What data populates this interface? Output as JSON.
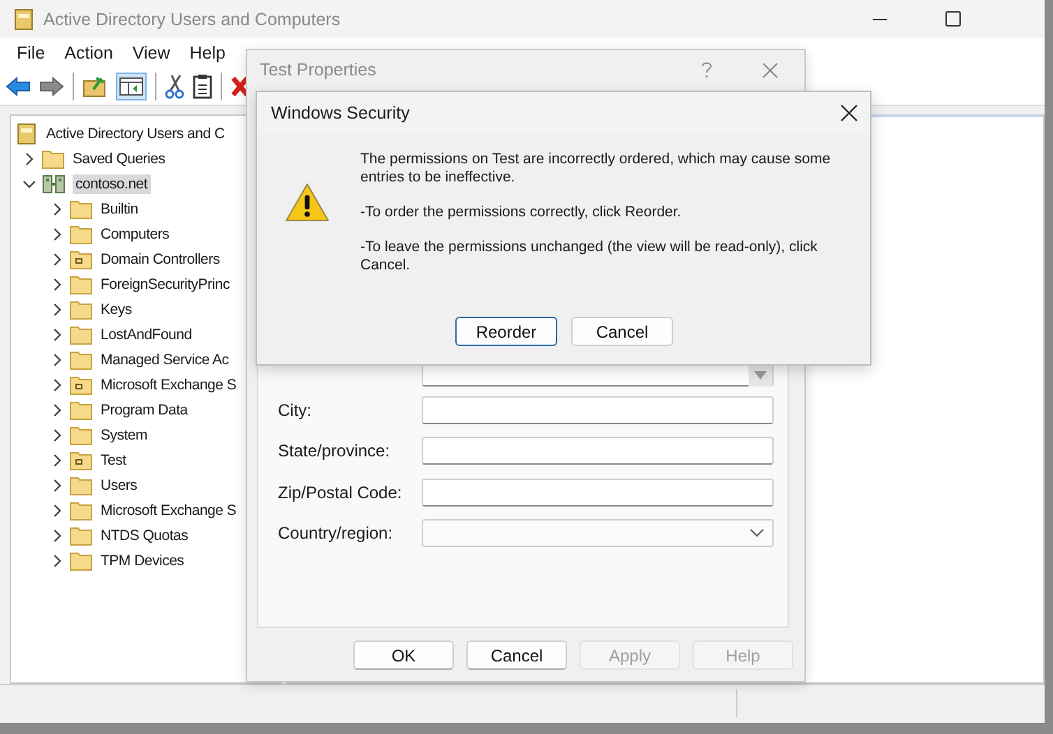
{
  "window": {
    "title": "Active Directory Users and Computers"
  },
  "menu": [
    "File",
    "Action",
    "View",
    "Help"
  ],
  "tree": [
    {
      "label": "Active Directory Users and C",
      "kind": "root",
      "selected": false,
      "children": [
        {
          "label": "Saved Queries",
          "kind": "folder",
          "expanded": false,
          "selected": false
        },
        {
          "label": "contoso.net",
          "kind": "domain",
          "expanded": true,
          "selected": true,
          "children": [
            {
              "label": "Builtin",
              "kind": "folder",
              "expanded": false,
              "selected": false
            },
            {
              "label": "Computers",
              "kind": "folder",
              "expanded": false,
              "selected": false
            },
            {
              "label": "Domain Controllers",
              "kind": "ou",
              "expanded": false,
              "selected": false
            },
            {
              "label": "ForeignSecurityPrinc",
              "kind": "folder",
              "expanded": false,
              "selected": false
            },
            {
              "label": "Keys",
              "kind": "folder",
              "expanded": false,
              "selected": false
            },
            {
              "label": "LostAndFound",
              "kind": "folder",
              "expanded": false,
              "selected": false
            },
            {
              "label": "Managed Service Ac",
              "kind": "folder",
              "expanded": false,
              "selected": false
            },
            {
              "label": "Microsoft Exchange S",
              "kind": "ou",
              "expanded": false,
              "selected": false
            },
            {
              "label": "Program Data",
              "kind": "folder",
              "expanded": false,
              "selected": false
            },
            {
              "label": "System",
              "kind": "folder",
              "expanded": false,
              "selected": false
            },
            {
              "label": "Test",
              "kind": "ou",
              "expanded": false,
              "selected": false
            },
            {
              "label": "Users",
              "kind": "folder",
              "expanded": false,
              "selected": false
            },
            {
              "label": "Microsoft Exchange S",
              "kind": "folder",
              "expanded": false,
              "selected": false
            },
            {
              "label": "NTDS Quotas",
              "kind": "folder",
              "expanded": false,
              "selected": false
            },
            {
              "label": "TPM Devices",
              "kind": "folder",
              "expanded": false,
              "selected": false
            }
          ]
        }
      ]
    }
  ],
  "properties_dialog": {
    "title": "Test Properties",
    "active": false,
    "fields": [
      {
        "kind": "dropdown"
      },
      {
        "kind": "text",
        "label": "City:"
      },
      {
        "kind": "text",
        "label": "State/province:"
      },
      {
        "kind": "text",
        "label": "Zip/Postal Code:"
      },
      {
        "kind": "combo",
        "label": "Country/region:"
      }
    ],
    "buttons": [
      {
        "label": "OK",
        "disabled": false
      },
      {
        "label": "Cancel",
        "disabled": false
      },
      {
        "label": "Apply",
        "disabled": true
      },
      {
        "label": "Help",
        "disabled": true
      }
    ]
  },
  "security_dialog": {
    "title": "Windows Security",
    "messages": [
      "The permissions on Test are incorrectly ordered, which may cause some entries to be ineffective.",
      "-To order the permissions correctly, click Reorder.",
      "-To leave the permissions unchanged (the view will be read-only), click Cancel."
    ],
    "buttons": [
      {
        "label": "Reorder",
        "default": true
      },
      {
        "label": "Cancel",
        "default": false
      }
    ]
  }
}
